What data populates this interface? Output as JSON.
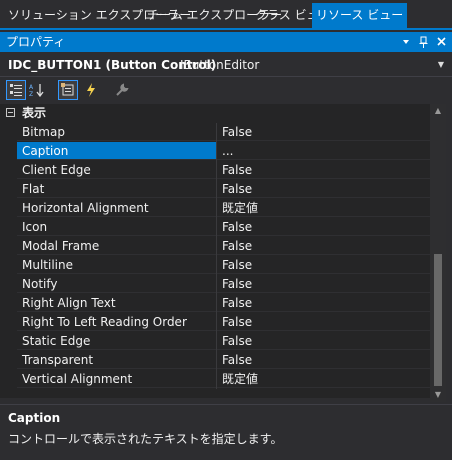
{
  "tabs": [
    {
      "label": "ソリューション エクスプローラー",
      "active": false
    },
    {
      "label": "チーム エクスプローラー",
      "active": false
    },
    {
      "label": "クラス ビュー",
      "active": false
    },
    {
      "label": "リソース ビュー",
      "active": true
    }
  ],
  "panel": {
    "title": "プロパティ",
    "icons": [
      "dropdown-arrow-icon",
      "pin-icon",
      "close-icon"
    ]
  },
  "object_selector": {
    "name": "IDC_BUTTON1 (Button Control)",
    "type": "IButtonEditor"
  },
  "toolbar": {
    "buttons": [
      "categorized-icon",
      "alphabetical-icon",
      "properties-icon",
      "events-icon",
      "property-pages-icon"
    ]
  },
  "category": {
    "label": "表示",
    "expanded": true
  },
  "properties": [
    {
      "name": "Bitmap",
      "value": "False"
    },
    {
      "name": "Caption",
      "value": "...",
      "selected": true
    },
    {
      "name": "Client Edge",
      "value": "False"
    },
    {
      "name": "Flat",
      "value": "False"
    },
    {
      "name": "Horizontal Alignment",
      "value": "既定値"
    },
    {
      "name": "Icon",
      "value": "False"
    },
    {
      "name": "Modal Frame",
      "value": "False"
    },
    {
      "name": "Multiline",
      "value": "False"
    },
    {
      "name": "Notify",
      "value": "False"
    },
    {
      "name": "Right Align Text",
      "value": "False"
    },
    {
      "name": "Right To Left Reading Order",
      "value": "False"
    },
    {
      "name": "Static Edge",
      "value": "False"
    },
    {
      "name": "Transparent",
      "value": "False"
    },
    {
      "name": "Vertical Alignment",
      "value": "既定値"
    }
  ],
  "description": {
    "title": "Caption",
    "text": "コントロールで表示されたテキストを指定します。"
  },
  "colors": {
    "accent": "#007acc",
    "background": "#2d2d30",
    "grid_background": "#252526"
  }
}
